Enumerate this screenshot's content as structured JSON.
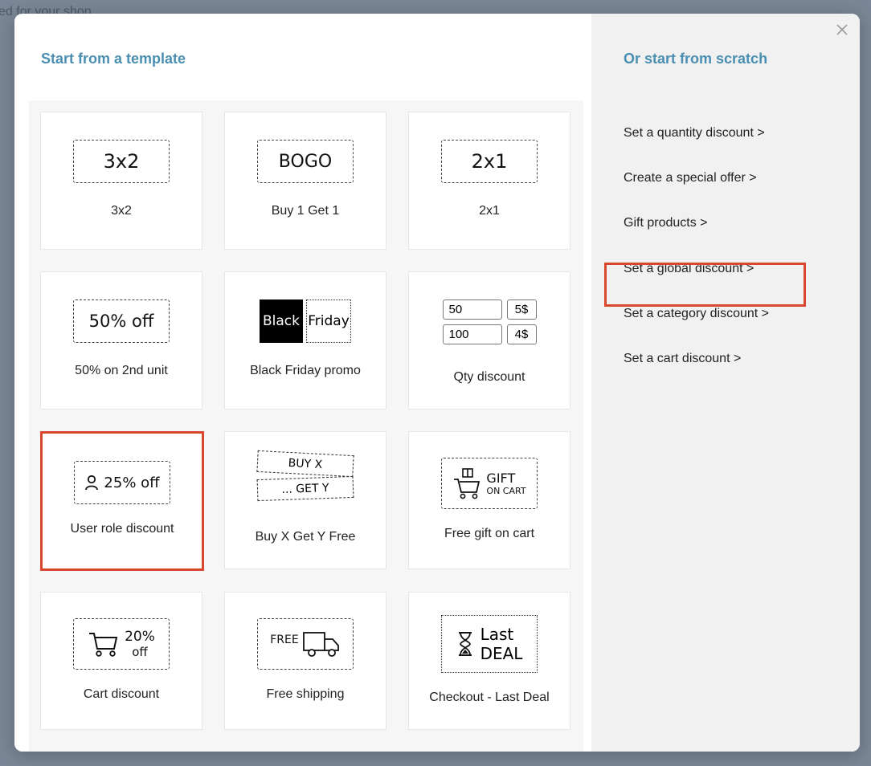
{
  "background": {
    "page_text": "ed for your shop"
  },
  "modal": {
    "left_title": "Start from a template",
    "right_title": "Or start from scratch",
    "close_icon": "close-icon"
  },
  "templates": [
    {
      "label": "3x2",
      "art_text": "3x2"
    },
    {
      "label": "Buy 1 Get 1",
      "art_text": "BOGO"
    },
    {
      "label": "2x1",
      "art_text": "2x1"
    },
    {
      "label": "50% on 2nd unit",
      "art_text": "50% off"
    },
    {
      "label": "Black Friday promo",
      "art_text_1": "Black",
      "art_text_2": "Friday"
    },
    {
      "label": "Qty discount",
      "qty_rows": [
        [
          "50",
          "5$"
        ],
        [
          "100",
          "4$"
        ]
      ]
    },
    {
      "label": "User role discount",
      "art_text": "25% off",
      "highlighted": true
    },
    {
      "label": "Buy X Get Y Free",
      "art_text_1": "BUY X",
      "art_text_2": "... GET Y"
    },
    {
      "label": "Free gift on cart",
      "art_text_1": "GIFT",
      "art_text_2": "ON CART"
    },
    {
      "label": "Cart discount",
      "art_text_1": "20%",
      "art_text_2": "off"
    },
    {
      "label": "Free shipping",
      "art_text": "FREE"
    },
    {
      "label": "Checkout - Last Deal",
      "art_text_1": "Last",
      "art_text_2": "DEAL"
    }
  ],
  "scratch_options": [
    {
      "label": "Set a quantity discount >"
    },
    {
      "label": "Create a special offer >"
    },
    {
      "label": "Gift products >"
    },
    {
      "label": "Set a global discount >",
      "highlighted": true
    },
    {
      "label": "Set a category discount >"
    },
    {
      "label": "Set a cart discount >"
    }
  ],
  "colors": {
    "accent_title": "#4a8fb2",
    "highlight": "#d9472b"
  }
}
